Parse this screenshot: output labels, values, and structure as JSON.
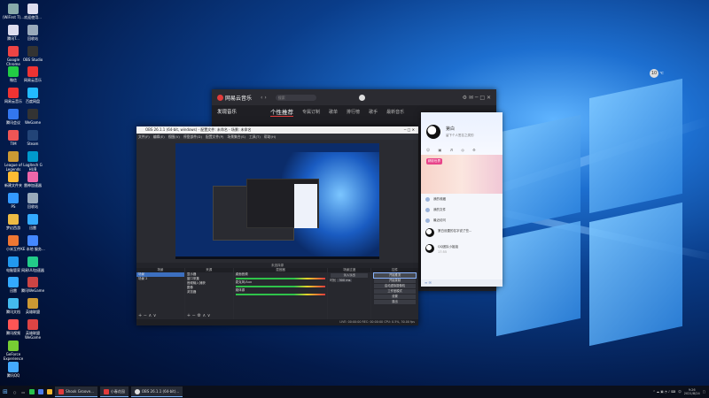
{
  "desktop": {
    "icons_col1": [
      "(WiFirst T)...",
      "腾讯T...",
      "Google Chrome",
      "微信",
      "网易云音乐",
      "腾讯会议",
      "TIM",
      "League of Legends",
      "新建文件夹",
      "PS",
      "梦幻西游",
      "小米互传",
      "电脑管家",
      "迅雷",
      "腾讯文档",
      "腾讯视频",
      "GeForce Experience",
      "腾讯QQ"
    ],
    "icons_col2": [
      "欢迎使用...",
      "回收站",
      "OBS Studio",
      "网易云音乐",
      "百度网盘",
      "WeGame",
      "Steam",
      "Logitech G HUB",
      "雷神加速器",
      "回收站",
      "迅雷",
      "KE 本地 服务...",
      "网易UU加速器",
      "腾讯WeGame",
      "英雄联盟",
      "英雄联盟WeGame"
    ],
    "weather": {
      "temp": "10",
      "label": "℃"
    }
  },
  "music": {
    "app_name": "网易云音乐",
    "search_placeholder": "搜索",
    "section_title": "发现音乐",
    "tabs": [
      "个性推荐",
      "专属订制",
      "歌单",
      "排行榜",
      "歌手",
      "最新音乐"
    ],
    "active_tab": "个性推荐"
  },
  "obs": {
    "title": "OBS 26.1.1 (64-bit, windows) - 配置文件: 未命名 - 场景: 未命名",
    "menu": [
      "文件(F)",
      "编辑(E)",
      "视图(V)",
      "停靠部件(D)",
      "配置文件(P)",
      "场景集合(S)",
      "工具(T)",
      "帮助(H)"
    ],
    "source_bar": "未选择源",
    "docks": {
      "scenes": {
        "header": "场景",
        "items": [
          "场景",
          "场景 2"
        ]
      },
      "sources": {
        "header": "来源",
        "items": [
          "显示器",
          "窗口采集",
          "音频输入捕获",
          "图像",
          "浏览器"
        ]
      },
      "mixer": {
        "header": "混音器",
        "items": [
          {
            "label": "桌面音频",
            "level": "0.0 dB"
          },
          {
            "label": "麦克风/Aux",
            "level": "0.0 dB"
          },
          {
            "label": "媒体源",
            "level": "0.0 dB"
          }
        ]
      },
      "transitions": {
        "header": "场景过渡",
        "type": "淡入淡出",
        "duration_label": "时长",
        "duration": "300 ms"
      },
      "controls": {
        "header": "控件",
        "buttons": [
          "开始推流",
          "开始录制",
          "启动虚拟摄像机",
          "工作室模式",
          "设置",
          "退出"
        ]
      }
    },
    "status": "LIVE: 00:00:00   REC: 00:00:00   CPU: 0.5%, 30.00 fps"
  },
  "qq": {
    "nickname": "第白",
    "signature": "留下个人签名之类的",
    "banner": "精彩世界",
    "items": [
      "我的收藏",
      "我的文件",
      "最近访问"
    ],
    "chat1": "第白设置的名字说了些...",
    "chat2": "QQ团队小姐姐",
    "time": "17:55"
  },
  "taskbar": {
    "tasks": [
      "Shook Groove...",
      "小春花园",
      "OBS 26.1.1 (64-bit)..."
    ],
    "time": "9:26",
    "date": "2021/8/24",
    "lang": "中"
  }
}
